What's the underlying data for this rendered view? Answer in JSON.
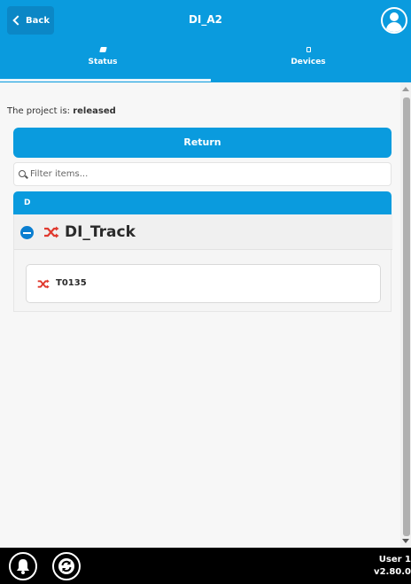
{
  "header": {
    "back_label": "Back",
    "title": "DI_A2"
  },
  "tabs": [
    {
      "label": "Status",
      "icon": "status-icon"
    },
    {
      "label": "Devices",
      "icon": "devices-icon"
    }
  ],
  "status": {
    "prefix": "The project is:",
    "value": "released"
  },
  "return_label": "Return",
  "filter": {
    "placeholder": "Filter items..."
  },
  "group": {
    "letter": "D",
    "item": {
      "name": "DI_Track",
      "children": [
        {
          "name": "T0135"
        }
      ]
    }
  },
  "footer": {
    "user": "User 1",
    "version": "v2.80.0"
  },
  "colors": {
    "accent": "#0a9bde",
    "shuffle_icon": "#e03a2f"
  }
}
